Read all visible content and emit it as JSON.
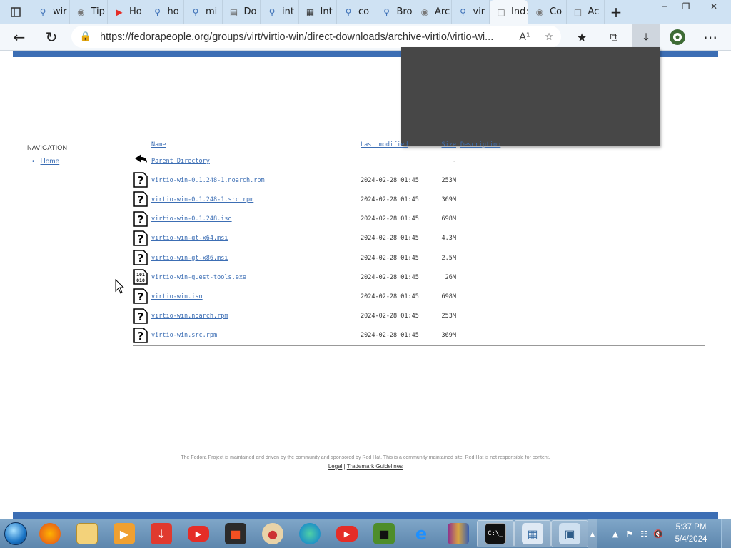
{
  "browser": {
    "tabs": [
      {
        "title": "wir",
        "icon": "search-icon"
      },
      {
        "title": "Tip",
        "icon": "site-icon"
      },
      {
        "title": "Ho",
        "icon": "youtube-icon"
      },
      {
        "title": "ho",
        "icon": "search-icon"
      },
      {
        "title": "mi",
        "icon": "search-icon"
      },
      {
        "title": "Do",
        "icon": "doc-icon"
      },
      {
        "title": "int",
        "icon": "search-icon"
      },
      {
        "title": "Int",
        "icon": "archive-icon"
      },
      {
        "title": "co",
        "icon": "search-icon"
      },
      {
        "title": "Bro",
        "icon": "search-icon"
      },
      {
        "title": "Arc",
        "icon": "site-icon"
      },
      {
        "title": "vir",
        "icon": "search-icon"
      },
      {
        "title": "Ind",
        "icon": "page-icon",
        "active": true
      },
      {
        "title": "Co",
        "icon": "site-icon"
      },
      {
        "title": "Ac",
        "icon": "page-icon"
      }
    ],
    "address": "https://fedorapeople.org/groups/virt/virtio-win/direct-downloads/archive-virtio/virtio-wi...",
    "read_aloud": "A¹",
    "colors": {
      "accent": "#3c6eb4",
      "tabbar": "#cfe2f3",
      "taskbar": "#6b93b8"
    }
  },
  "nav": {
    "heading": "NAVIGATION",
    "home": "Home"
  },
  "listing": {
    "headers": {
      "name": "Name",
      "modified": "Last modified",
      "size": "Size",
      "description": "Description"
    },
    "parent": {
      "name": "Parent Directory",
      "size": "-"
    },
    "files": [
      {
        "name": "virtio-win-0.1.248-1.noarch.rpm",
        "modified": "2024-02-28 01:45",
        "size": "253M",
        "icon": "unknown-file-icon"
      },
      {
        "name": "virtio-win-0.1.248-1.src.rpm",
        "modified": "2024-02-28 01:45",
        "size": "369M",
        "icon": "unknown-file-icon"
      },
      {
        "name": "virtio-win-0.1.248.iso",
        "modified": "2024-02-28 01:45",
        "size": "698M",
        "icon": "unknown-file-icon"
      },
      {
        "name": "virtio-win-gt-x64.msi",
        "modified": "2024-02-28 01:45",
        "size": "4.3M",
        "icon": "unknown-file-icon"
      },
      {
        "name": "virtio-win-gt-x86.msi",
        "modified": "2024-02-28 01:45",
        "size": "2.5M",
        "icon": "unknown-file-icon"
      },
      {
        "name": "virtio-win-guest-tools.exe",
        "modified": "2024-02-28 01:45",
        "size": "26M",
        "icon": "binary-file-icon"
      },
      {
        "name": "virtio-win.iso",
        "modified": "2024-02-28 01:45",
        "size": "698M",
        "icon": "unknown-file-icon"
      },
      {
        "name": "virtio-win.noarch.rpm",
        "modified": "2024-02-28 01:45",
        "size": "253M",
        "icon": "unknown-file-icon"
      },
      {
        "name": "virtio-win.src.rpm",
        "modified": "2024-02-28 01:45",
        "size": "369M",
        "icon": "unknown-file-icon"
      }
    ]
  },
  "footer": {
    "text": "The Fedora Project is maintained and driven by the community and sponsored by Red Hat. This is a community maintained site. Red Hat is not responsible for content.",
    "legal": "Legal",
    "sep": "|",
    "trademark": "Trademark Guidelines"
  },
  "taskbar": {
    "time": "5:37 PM",
    "date": "5/4/2024"
  }
}
